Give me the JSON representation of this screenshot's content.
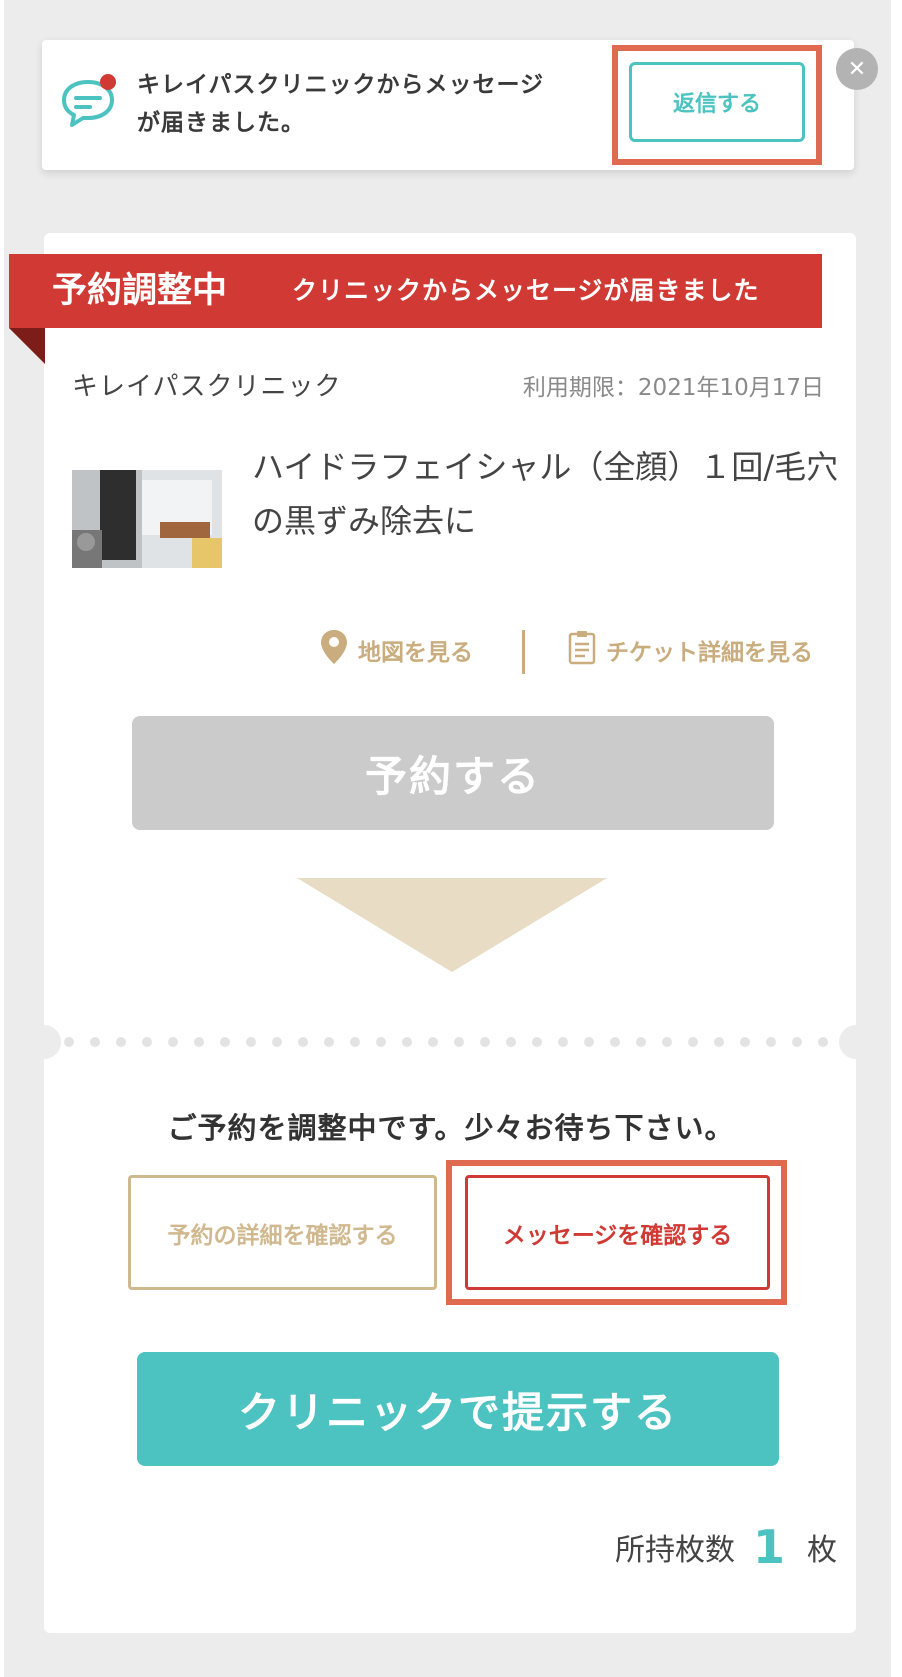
{
  "notification": {
    "icon": "message-bubble-icon",
    "message": "キレイパスクリニックからメッセージが届きました。",
    "reply_label": "返信する",
    "close_icon": "close-icon"
  },
  "ticket": {
    "status_badge": "予約調整中",
    "status_message": "クリニックからメッセージが届きました",
    "clinic_name": "キレイパスクリニック",
    "expiry": "利用期限：2021年10月17日",
    "title": "ハイドラフェイシャル（全顔）１回/毛穴の黒ずみ除去に",
    "links": {
      "map_label": "地図を見る",
      "map_icon": "map-pin-icon",
      "ticket_detail_label": "チケット詳細を見る",
      "ticket_detail_icon": "clipboard-icon"
    },
    "reserve_label": "予約する",
    "waiting_text": "ご予約を調整中です。少々お待ち下さい。",
    "detail_button_label": "予約の詳細を確認する",
    "message_button_label": "メッセージを確認する",
    "present_button_label": "クリニックで提示する",
    "owned_count": {
      "prefix": "所持枚数",
      "value": "1",
      "suffix": "枚"
    }
  },
  "colors": {
    "accent_teal": "#4cc3c0",
    "status_red": "#d13a34",
    "gold": "#c9ad7e",
    "highlight": "#e06a4f",
    "disabled_gray": "#cbcbcb"
  }
}
